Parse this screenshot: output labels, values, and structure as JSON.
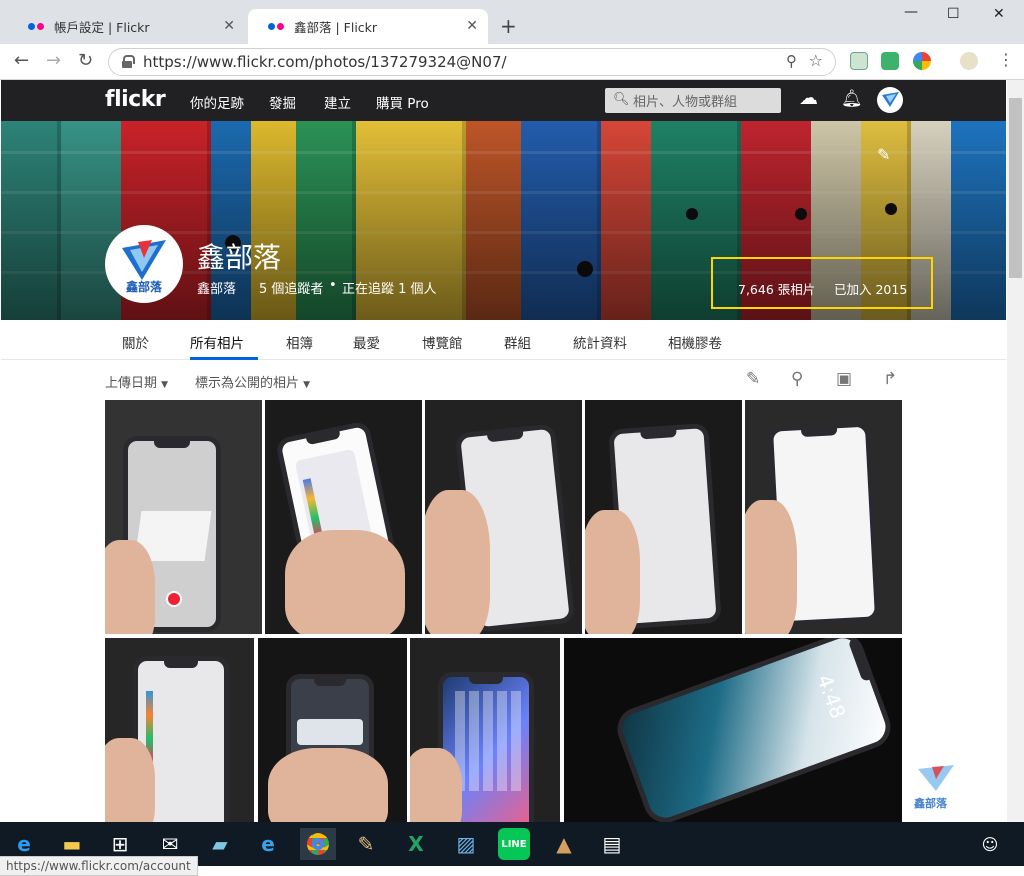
{
  "browser": {
    "tabs": [
      {
        "label": "帳戶設定 | Flickr"
      },
      {
        "label": "鑫部落 | Flickr"
      }
    ],
    "url": "https://www.flickr.com/photos/137279324@N07/",
    "new_tab_symbol": "+",
    "status_url": "https://www.flickr.com/account"
  },
  "flickr": {
    "logo": "flickr",
    "nav": [
      "你的足跡",
      "發掘",
      "建立",
      "購買 Pro"
    ],
    "search_placeholder": "相片、人物或群組",
    "colors": {
      "brand_blue": "#0063dc",
      "brand_pink": "#ff0084",
      "header_bg": "#212124",
      "highlight_box": "#ffd700"
    }
  },
  "profile": {
    "name": "鑫部落",
    "username": "鑫部落",
    "followers": "5 個追蹤者",
    "following": "正在追蹤 1 個人",
    "photo_count": "7,646 張相片",
    "joined": "已加入 2015",
    "avatar_text": "鑫部落"
  },
  "subnav": {
    "items": [
      "關於",
      "所有相片",
      "相簿",
      "最愛",
      "博覽館",
      "群組",
      "統計資料",
      "相機膠卷"
    ],
    "active": "所有相片"
  },
  "filters": {
    "sort": "上傳日期",
    "visibility": "標示為公開的相片"
  },
  "photos": {
    "phone_time": "4:48",
    "watermark": "鑫部落"
  }
}
